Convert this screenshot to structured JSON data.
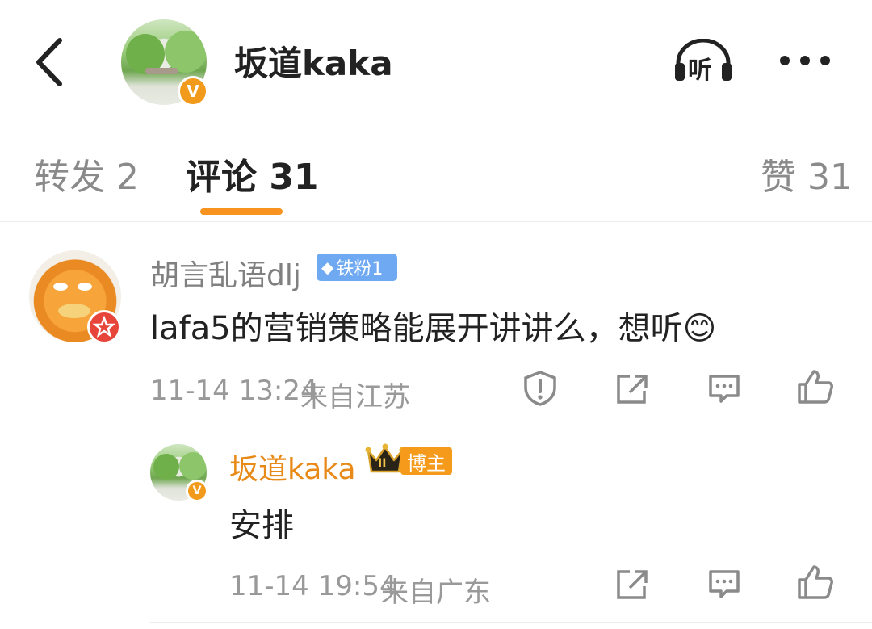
{
  "header": {
    "back_icon": "chevron-left-icon",
    "account_name": "坂道kaka",
    "verified_badge": "V",
    "listen_icon": "headphones-icon",
    "listen_label": "听",
    "more_icon": "more-dots-icon"
  },
  "tabs": {
    "repost": "转发 2",
    "comment": "评论 31",
    "like": "赞 31"
  },
  "comments": [
    {
      "username": "胡言乱语dlj",
      "fan_badge": "铁粉1",
      "text": "lafa5的营销策略能展开讲讲么，想听😊",
      "time": "11-14 13:24",
      "location": "来自江苏"
    }
  ],
  "reply": {
    "username": "坂道kaka",
    "host_badge": "博主",
    "crown_level": "II",
    "verified_badge": "V",
    "text": "安排",
    "time": "11-14 19:54",
    "location": "来自广东"
  },
  "colors": {
    "accent": "#f7931e",
    "fan_badge": "#6fa9f2",
    "host_name": "#e88a17"
  }
}
